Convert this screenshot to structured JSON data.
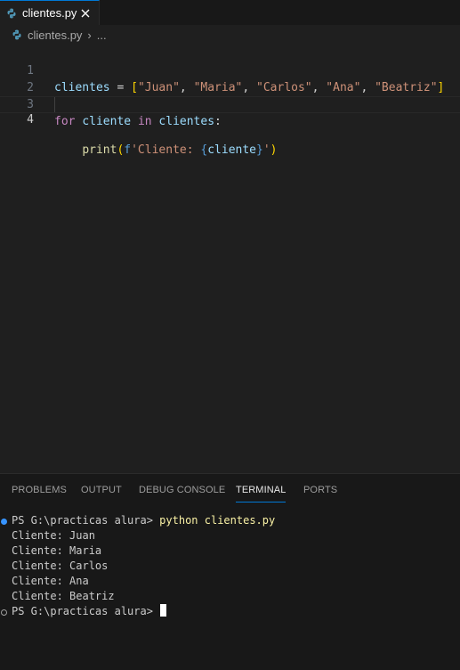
{
  "tabs": [
    {
      "label": "clientes.py",
      "icon": "python-icon",
      "active": true
    }
  ],
  "breadcrumb": {
    "file": "clientes.py",
    "separator": "›",
    "more": "..."
  },
  "editor": {
    "lines": [
      {
        "number": "1",
        "text": "clientes = [\"Juan\", \"Maria\", \"Carlos\", \"Ana\", \"Beatriz\"]"
      },
      {
        "number": "2",
        "text": ""
      },
      {
        "number": "3",
        "text": "for cliente in clientes:"
      },
      {
        "number": "4",
        "text": "    print(f'Cliente: {cliente}')"
      }
    ],
    "active_line": "4",
    "tokens": {
      "var_clientes": "clientes",
      "eq": " = ",
      "bracket_open": "[",
      "s1": "\"Juan\"",
      "s2": "\"Maria\"",
      "s3": "\"Carlos\"",
      "s4": "\"Ana\"",
      "s5": "\"Beatriz\"",
      "comma": ", ",
      "bracket_close": "]",
      "kw_for": "for",
      "var_cliente": "cliente",
      "kw_in": "in",
      "colon": ":",
      "fn_print": "print",
      "paren_open": "(",
      "f_prefix": "f",
      "str_part": "'Cliente: ",
      "brace_open": "{",
      "brace_close": "}",
      "str_end": "'",
      "paren_close": ")"
    }
  },
  "panel": {
    "tabs": [
      "PROBLEMS",
      "OUTPUT",
      "DEBUG CONSOLE",
      "TERMINAL",
      "PORTS"
    ],
    "active_tab": "TERMINAL"
  },
  "terminal": {
    "prompt": "PS G:\\practicas alura> ",
    "command": "python clientes.py",
    "output": [
      "Cliente: Juan",
      "Cliente: Maria",
      "Cliente: Carlos",
      "Cliente: Ana",
      "Cliente: Beatriz"
    ],
    "final_prompt": "PS G:\\practicas alura> "
  },
  "colors": {
    "accent": "#0078d4",
    "python_icon": "#519aba",
    "success_decoration": "#3794ff"
  }
}
